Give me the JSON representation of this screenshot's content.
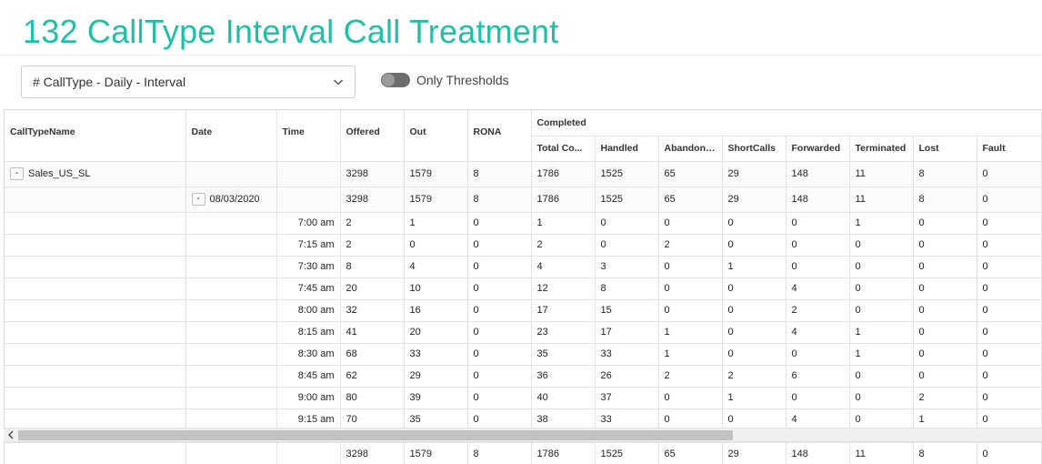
{
  "page": {
    "title": "132 CallType Interval Call Treatment"
  },
  "filter": {
    "selected": "# CallType - Daily - Interval",
    "icon": "chevron-down-icon"
  },
  "toggle": {
    "label": "Only Thresholds",
    "on": false
  },
  "colors": {
    "accent": "#1fbfa8"
  },
  "grid": {
    "group_header": "Completed",
    "columns": {
      "calltype": "CallTypeName",
      "date": "Date",
      "time": "Time",
      "offered": "Offered",
      "out": "Out",
      "rona": "RONA",
      "total": "Total Co...",
      "handled": "Handled",
      "abandoned": "Abandoned",
      "shortcalls": "ShortCalls",
      "forwarded": "Forwarded",
      "terminated": "Terminated",
      "lost": "Lost",
      "fault": "Fault"
    },
    "expander_symbol": "-",
    "group_row": {
      "name": "Sales_US_SL",
      "values": [
        "3298",
        "1579",
        "8",
        "1786",
        "1525",
        "65",
        "29",
        "148",
        "11",
        "8",
        "0"
      ]
    },
    "date_row": {
      "date": "08/03/2020",
      "values": [
        "3298",
        "1579",
        "8",
        "1786",
        "1525",
        "65",
        "29",
        "148",
        "11",
        "8",
        "0"
      ]
    },
    "rows": [
      {
        "time": "7:00 am",
        "values": [
          "2",
          "1",
          "0",
          "1",
          "0",
          "0",
          "0",
          "0",
          "1",
          "0",
          "0"
        ]
      },
      {
        "time": "7:15 am",
        "values": [
          "2",
          "0",
          "0",
          "2",
          "0",
          "2",
          "0",
          "0",
          "0",
          "0",
          "0"
        ]
      },
      {
        "time": "7:30 am",
        "values": [
          "8",
          "4",
          "0",
          "4",
          "3",
          "0",
          "1",
          "0",
          "0",
          "0",
          "0"
        ]
      },
      {
        "time": "7:45 am",
        "values": [
          "20",
          "10",
          "0",
          "12",
          "8",
          "0",
          "0",
          "4",
          "0",
          "0",
          "0"
        ]
      },
      {
        "time": "8:00 am",
        "values": [
          "32",
          "16",
          "0",
          "17",
          "15",
          "0",
          "0",
          "2",
          "0",
          "0",
          "0"
        ]
      },
      {
        "time": "8:15 am",
        "values": [
          "41",
          "20",
          "0",
          "23",
          "17",
          "1",
          "0",
          "4",
          "1",
          "0",
          "0"
        ]
      },
      {
        "time": "8:30 am",
        "values": [
          "68",
          "33",
          "0",
          "35",
          "33",
          "1",
          "0",
          "0",
          "1",
          "0",
          "0"
        ]
      },
      {
        "time": "8:45 am",
        "values": [
          "62",
          "29",
          "0",
          "36",
          "26",
          "2",
          "2",
          "6",
          "0",
          "0",
          "0"
        ]
      },
      {
        "time": "9:00 am",
        "values": [
          "80",
          "39",
          "0",
          "40",
          "37",
          "0",
          "1",
          "0",
          "0",
          "2",
          "0"
        ]
      },
      {
        "time": "9:15 am",
        "values": [
          "70",
          "35",
          "0",
          "38",
          "33",
          "0",
          "0",
          "4",
          "0",
          "1",
          "0"
        ]
      }
    ],
    "totals": [
      "3298",
      "1579",
      "8",
      "1786",
      "1525",
      "65",
      "29",
      "148",
      "11",
      "8",
      "0"
    ]
  },
  "scrollbar": {
    "left_arrow": "‹"
  }
}
